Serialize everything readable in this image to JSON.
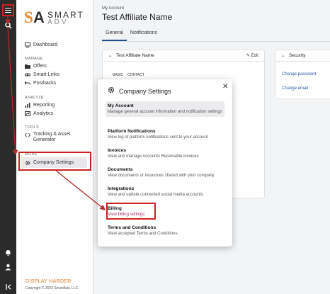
{
  "sidebar": {
    "brand": {
      "mark_s": "S",
      "mark_a": "A",
      "name": "SMART",
      "tag": "ADV"
    },
    "sections": [
      {
        "label": "MANAGE"
      },
      {
        "label": "ANALYZE"
      },
      {
        "label": "TOOLS"
      },
      {
        "label": "MORE"
      }
    ],
    "items": [
      {
        "label": "Dashboard",
        "icon": "monitor-icon"
      },
      {
        "label": "Offers",
        "icon": "folder-icon"
      },
      {
        "label": "Smart Links",
        "icon": "link-icon"
      },
      {
        "label": "Postbacks",
        "icon": "undo-icon"
      },
      {
        "label": "Reporting",
        "icon": "chart-icon"
      },
      {
        "label": "Analytics",
        "icon": "analytics-icon"
      },
      {
        "label": "Tracking & Asset Generator",
        "icon": "code-icon"
      },
      {
        "label": "Company Settings",
        "icon": "gear-icon"
      }
    ],
    "footer_brand": "DISPLAY HARDER",
    "footer_copy": "Copyright © 2023 SmartAds, LLC"
  },
  "header": {
    "breadcrumb": "My Account",
    "title": "Test Affiliate Name",
    "tabs": [
      {
        "label": "General"
      },
      {
        "label": "Notifications"
      }
    ]
  },
  "account_card": {
    "title": "Test Affiliate Name",
    "edit_label": "Edit",
    "mini_tabs": [
      "BASIC",
      "CONTACT"
    ]
  },
  "security_card": {
    "title": "Security",
    "links": [
      "Change password",
      "Change email"
    ]
  },
  "modal": {
    "title": "Company Settings",
    "options": [
      {
        "title": "My Account",
        "desc": "Manage general account information and notification settings"
      },
      {
        "title": "Platform Notifications",
        "desc": "View log of platform notifications sent to your account"
      },
      {
        "title": "Invoices",
        "desc": "View and manage Accounts Receivable invoices"
      },
      {
        "title": "Documents",
        "desc": "View documents or resources shared with your company"
      },
      {
        "title": "Integrations",
        "desc": "View and update connected social media accounts"
      },
      {
        "title": "Billing",
        "desc": "View billing settings"
      },
      {
        "title": "Terms and Conditions",
        "desc": "View accepted Terms and Conditions"
      }
    ]
  },
  "colors": {
    "accent": "#1f4e8c",
    "brand_orange": "#f08a2a",
    "highlight": "#cc2222",
    "rail": "#2b2b2b"
  }
}
